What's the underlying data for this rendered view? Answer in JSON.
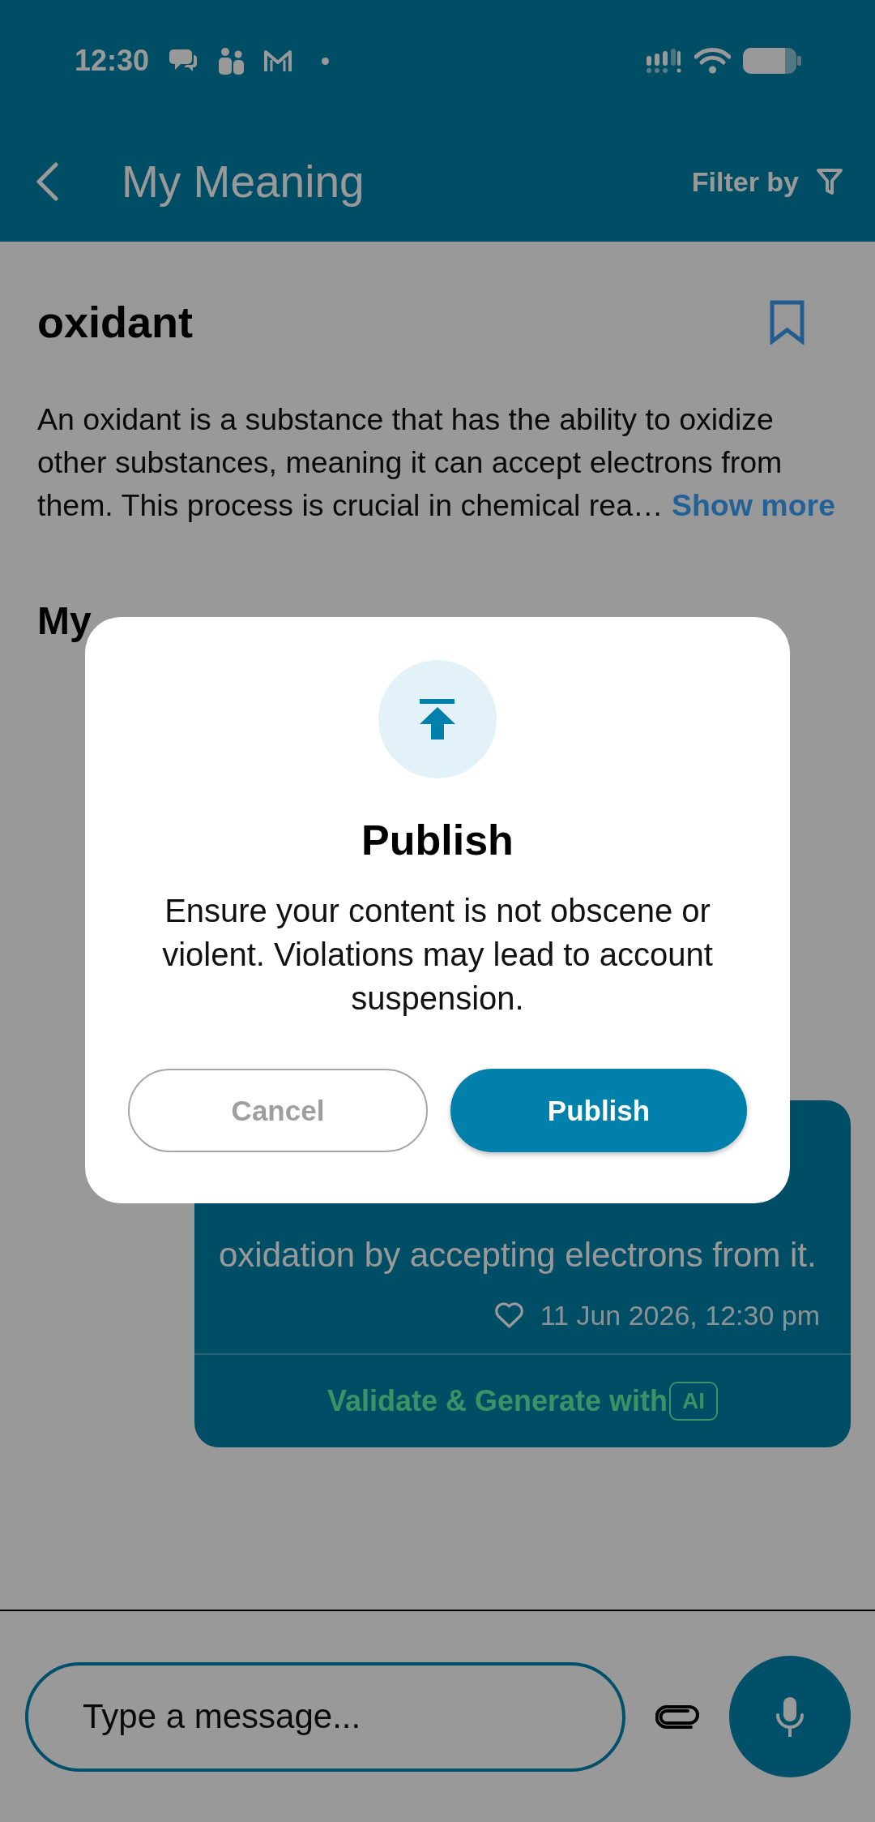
{
  "status_bar": {
    "time": "12:30"
  },
  "header": {
    "title": "My Meaning",
    "filter_label": "Filter by"
  },
  "word": {
    "title": "oxidant",
    "bookmarked": false,
    "definition": "An oxidant is a substance that has the ability to oxidize other substances, meaning it can accept electrons from them. This process is crucial in chemical rea…",
    "show_more": "Show more"
  },
  "section_title": "My",
  "dialog": {
    "title": "Publish",
    "message": "Ensure your content is not obscene or violent. Violations may lead to account suspension.",
    "buttons": [
      {
        "kind": "secondary",
        "label": "Cancel"
      },
      {
        "kind": "primary",
        "label": "Publish"
      }
    ]
  },
  "meaning": {
    "text": "oxidation by accepting electrons from it.",
    "liked": false,
    "timestamp": "11 Jun 2026, 12:30 pm",
    "action": "Validate & Generate with",
    "badge": "AI"
  },
  "composer": {
    "placeholder": "Type a message..."
  }
}
